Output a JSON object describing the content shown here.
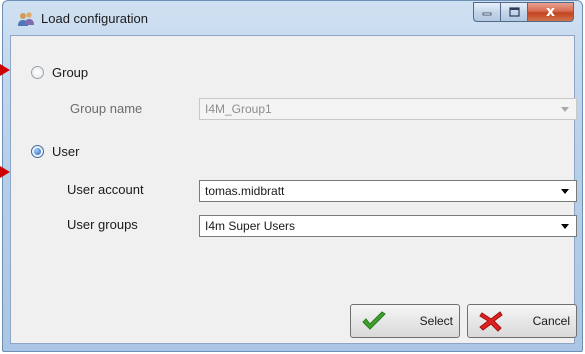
{
  "window": {
    "title": "Load configuration",
    "close_glyph": "x"
  },
  "group_option": {
    "label": "Group",
    "selected": false,
    "name_label": "Group name",
    "name_value": "I4M_Group1"
  },
  "user_option": {
    "label": "User",
    "selected": true,
    "account_label": "User account",
    "account_value": "tomas.midbratt",
    "groups_label": "User groups",
    "groups_value": "I4m Super Users"
  },
  "buttons": {
    "select_label": "Select",
    "cancel_label": "Cancel"
  },
  "icons": {
    "app": "users-icon",
    "select": "checkmark-icon",
    "cancel": "red-x-icon"
  },
  "colors": {
    "annotation_arrow": "#cc0000",
    "radio_selected": "#1d5fb3",
    "close_button": "#c2431f",
    "checkmark": "#3fa02b"
  }
}
